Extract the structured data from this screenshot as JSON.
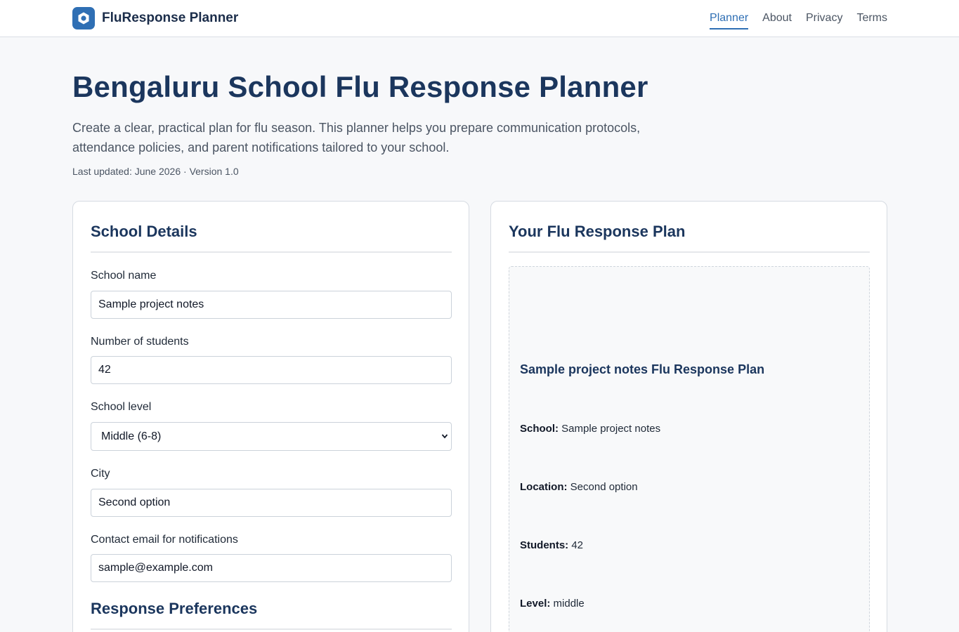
{
  "header": {
    "brand": "FluResponse Planner",
    "nav": [
      {
        "label": "Planner",
        "active": true
      },
      {
        "label": "About",
        "active": false
      },
      {
        "label": "Privacy",
        "active": false
      },
      {
        "label": "Terms",
        "active": false
      }
    ]
  },
  "hero": {
    "title": "Bengaluru School Flu Response Planner",
    "description": "Create a clear, practical plan for flu season. This planner helps you prepare communication protocols, attendance policies, and parent notifications tailored to your school.",
    "meta": "Last updated: June 2026 · Version 1.0"
  },
  "form": {
    "section_title": "School Details",
    "fields": {
      "school_name": {
        "label": "School name",
        "value": "Sample project notes"
      },
      "students": {
        "label": "Number of students",
        "value": "42"
      },
      "level": {
        "label": "School level",
        "value": "Middle (6-8)"
      },
      "city": {
        "label": "City",
        "value": "Second option"
      },
      "email": {
        "label": "Contact email for notifications",
        "value": "sample@example.com"
      }
    },
    "section2_title": "Response Preferences"
  },
  "plan": {
    "section_title": "Your Flu Response Plan",
    "title": "Sample project notes Flu Response Plan",
    "rows": [
      {
        "key": "School:",
        "value": "Sample project notes"
      },
      {
        "key": "Location:",
        "value": "Second option"
      },
      {
        "key": "Students:",
        "value": "42"
      },
      {
        "key": "Level:",
        "value": "middle"
      }
    ]
  },
  "colors": {
    "accent": "#2f6fb4",
    "heading": "#1b365d",
    "background": "#f7f8fa"
  }
}
